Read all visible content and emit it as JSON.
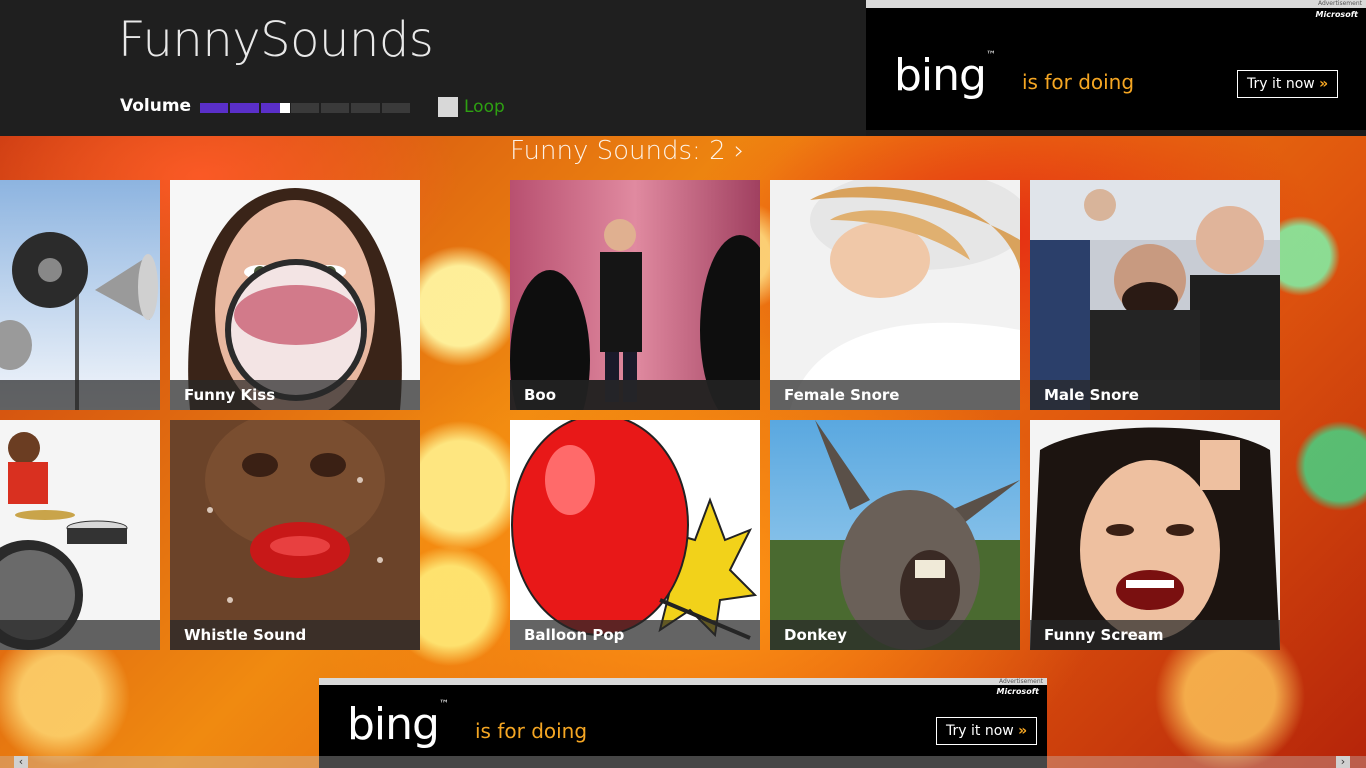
{
  "app": {
    "title": "FunnySounds"
  },
  "controls": {
    "volume_label": "Volume",
    "volume_level": 0.4,
    "loop_label": "Loop",
    "loop_checked": false,
    "accent_color": "#5a2fc9",
    "loop_color": "#2ea012"
  },
  "ads": {
    "top": {
      "tag": "Advertisement",
      "brand": "Microsoft",
      "logo": "bing",
      "tagline": "is for doing",
      "cta": "Try it now",
      "cta_icon": "double-chevron-right-icon"
    },
    "bottom": {
      "tag": "Advertisement",
      "brand": "Microsoft",
      "logo": "bing",
      "tagline": "is for doing",
      "cta": "Try it now",
      "cta_icon": "double-chevron-right-icon"
    }
  },
  "group": {
    "title": "Funny Sounds: 2",
    "chevron": "›"
  },
  "tiles_left": [
    {
      "label": "",
      "image": "loudspeakers"
    },
    {
      "label": "Funny Kiss",
      "image": "woman-kiss-magnifier"
    },
    {
      "label": "",
      "image": "child-drummer"
    },
    {
      "label": "Whistle Sound",
      "image": "red-lips-whistle"
    }
  ],
  "tiles_right": [
    {
      "label": "Boo",
      "image": "stage-performer"
    },
    {
      "label": "Female Snore",
      "image": "sleeping-woman"
    },
    {
      "label": "Male Snore",
      "image": "sleeping-man-plane"
    },
    {
      "label": "Balloon Pop",
      "image": "red-balloon"
    },
    {
      "label": "Donkey",
      "image": "braying-donkey"
    },
    {
      "label": "Funny Scream",
      "image": "screaming-woman"
    }
  ]
}
